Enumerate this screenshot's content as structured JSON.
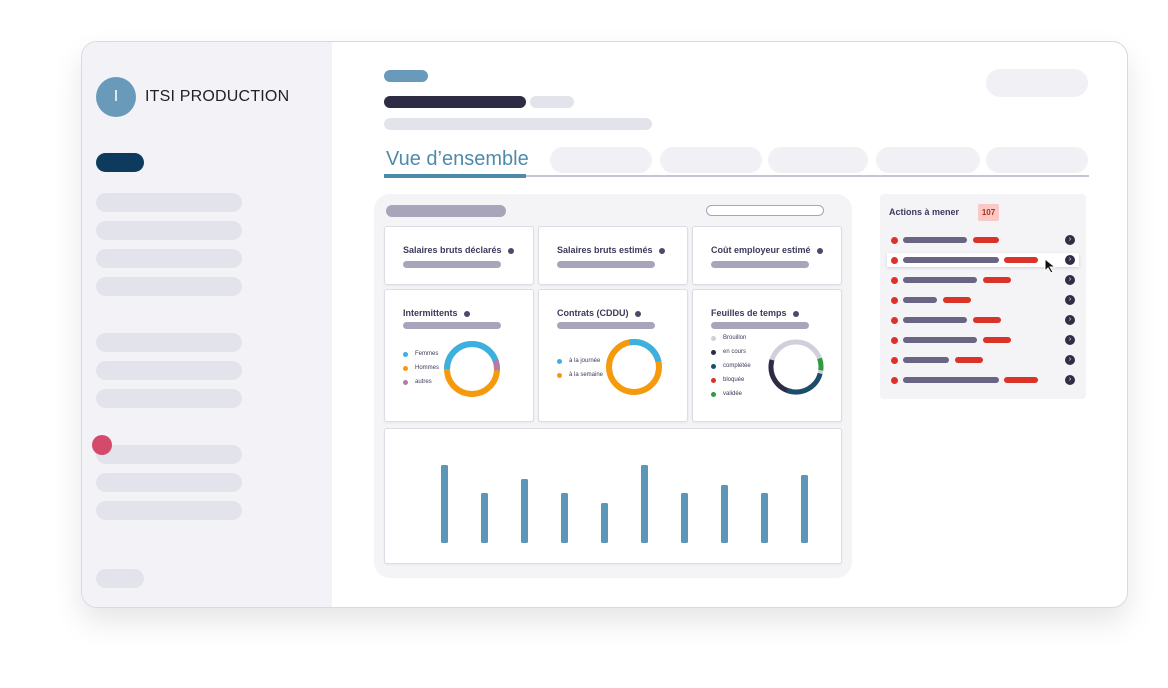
{
  "company": {
    "initial": "I",
    "name": "ITSI PRODUCTION"
  },
  "tabs": {
    "active_label": "Vue d’ensemble"
  },
  "cards": {
    "salaires_bruts_declares": "Salaires bruts déclarés",
    "salaires_bruts_estimes": "Salaires bruts estimés",
    "cout_employeur": "Coût employeur estimé",
    "intermittents": {
      "title": "Intermittents",
      "legend": [
        {
          "label": "Femmes",
          "color": "#3bb0e2"
        },
        {
          "label": "Hommes",
          "color": "#f59a0c"
        },
        {
          "label": "autres",
          "color": "#b57aa8"
        }
      ]
    },
    "contrats": {
      "title": "Contrats (CDDU)",
      "legend": [
        {
          "label": "à la journée",
          "color": "#3bb0e2"
        },
        {
          "label": "à la semaine",
          "color": "#f59a0c"
        }
      ]
    },
    "feuilles": {
      "title": "Feuilles de temps",
      "legend": [
        {
          "label": "Brouillon",
          "color": "#d0d0dc"
        },
        {
          "label": "en cours",
          "color": "#2e2b45"
        },
        {
          "label": "complétée",
          "color": "#1b4e6b"
        },
        {
          "label": "bloquée",
          "color": "#d9332a"
        },
        {
          "label": "validée",
          "color": "#2f9a3e"
        }
      ]
    }
  },
  "actions": {
    "title": "Actions à mener",
    "count": "107"
  },
  "colors": {
    "accent": "#4e8bab",
    "navy": "#0e3a5e",
    "alert": "#d9332a",
    "bar": "#5d97b8"
  },
  "chart_data": {
    "type": "bar",
    "values": [
      78,
      50,
      64,
      50,
      40,
      78,
      50,
      58,
      50,
      68
    ],
    "title": "",
    "xlabel": "",
    "ylabel": ""
  }
}
